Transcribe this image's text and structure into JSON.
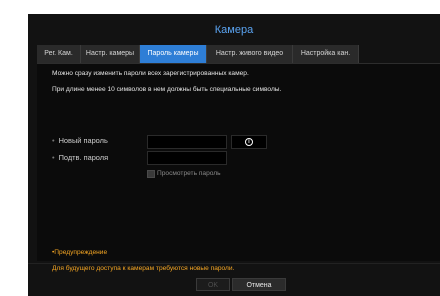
{
  "window": {
    "title": "Камера"
  },
  "tabs": [
    {
      "label": "Рег. Кам.",
      "active": false
    },
    {
      "label": "Настр. камеры",
      "active": false
    },
    {
      "label": "Пароль камеры",
      "active": true
    },
    {
      "label": "Настр. живого видео",
      "active": false
    },
    {
      "label": "Настройка кан.",
      "active": false
    }
  ],
  "info": {
    "line1": "Можно сразу изменить пароли всех зарегистрированных камер.",
    "line2": "При длине менее 10 символов в нем должны быть специальные символы."
  },
  "form": {
    "new_password": {
      "label": "Новый пароль",
      "value": ""
    },
    "confirm_password": {
      "label": "Подтв. пароля",
      "value": ""
    },
    "info_icon": "info-circle-icon",
    "show_password": {
      "label": "Просмотреть пароль",
      "checked": false
    }
  },
  "warning": {
    "title": "•Предупреждение",
    "text": "Для будущего доступа к камерам требуются  новые пароли."
  },
  "footer": {
    "ok_label": "OK",
    "cancel_label": "Отмена"
  },
  "colors": {
    "accent": "#2e7ed6",
    "title": "#5aa3f0",
    "warning": "#f5a623",
    "background": "#121212"
  }
}
